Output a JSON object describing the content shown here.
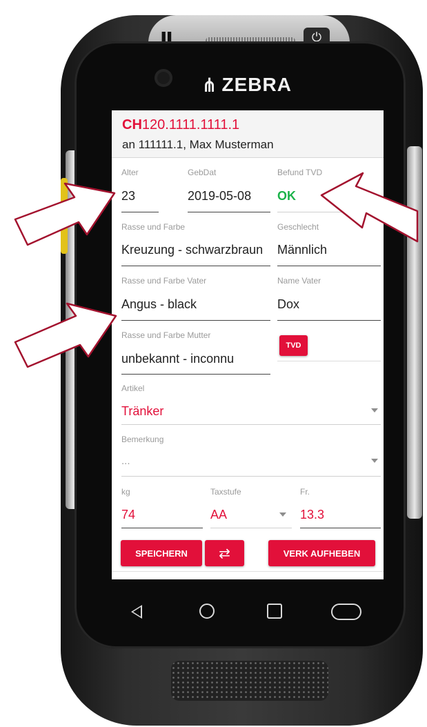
{
  "device": {
    "brand": "ZEBRA",
    "pause_label": "II",
    "power_glyph": "⏻"
  },
  "header": {
    "prefix": "CH",
    "id": "120.1111.1111.1",
    "line2": "an  111111.1, Max Musterman"
  },
  "form": {
    "alter": {
      "label": "Alter",
      "value": "23"
    },
    "gebdat": {
      "label": "GebDat",
      "value": "2019-05-08"
    },
    "befund_tvd": {
      "label": "Befund TVD",
      "value": "OK"
    },
    "rasse_farbe": {
      "label": "Rasse und Farbe",
      "value": "Kreuzung - schwarzbraun"
    },
    "geschlecht": {
      "label": "Geschlecht",
      "value": "Männlich"
    },
    "rasse_farbe_vater": {
      "label": "Rasse und Farbe Vater",
      "value": "Angus - black"
    },
    "name_vater": {
      "label": "Name Vater",
      "value": "Dox"
    },
    "rasse_farbe_mutter": {
      "label": "Rasse und Farbe Mutter",
      "value": "unbekannt - inconnu"
    },
    "tvd_button": "TVD",
    "artikel": {
      "label": "Artikel",
      "value": "Tränker"
    },
    "bemerkung": {
      "label": "Bemerkung",
      "placeholder": "..."
    },
    "kg": {
      "label": "kg",
      "value": "74"
    },
    "taxstufe": {
      "label": "Taxstufe",
      "value": "AA"
    },
    "fr": {
      "label": "Fr.",
      "value": "13.3"
    }
  },
  "actions": {
    "save": "SPEICHERN",
    "swap_glyph": "⇄",
    "cancel_sale": "VERK AUFHEBEN"
  },
  "colors": {
    "accent": "#e2103a",
    "ok": "#1bb34a",
    "arrow_stroke": "#a3122e"
  }
}
